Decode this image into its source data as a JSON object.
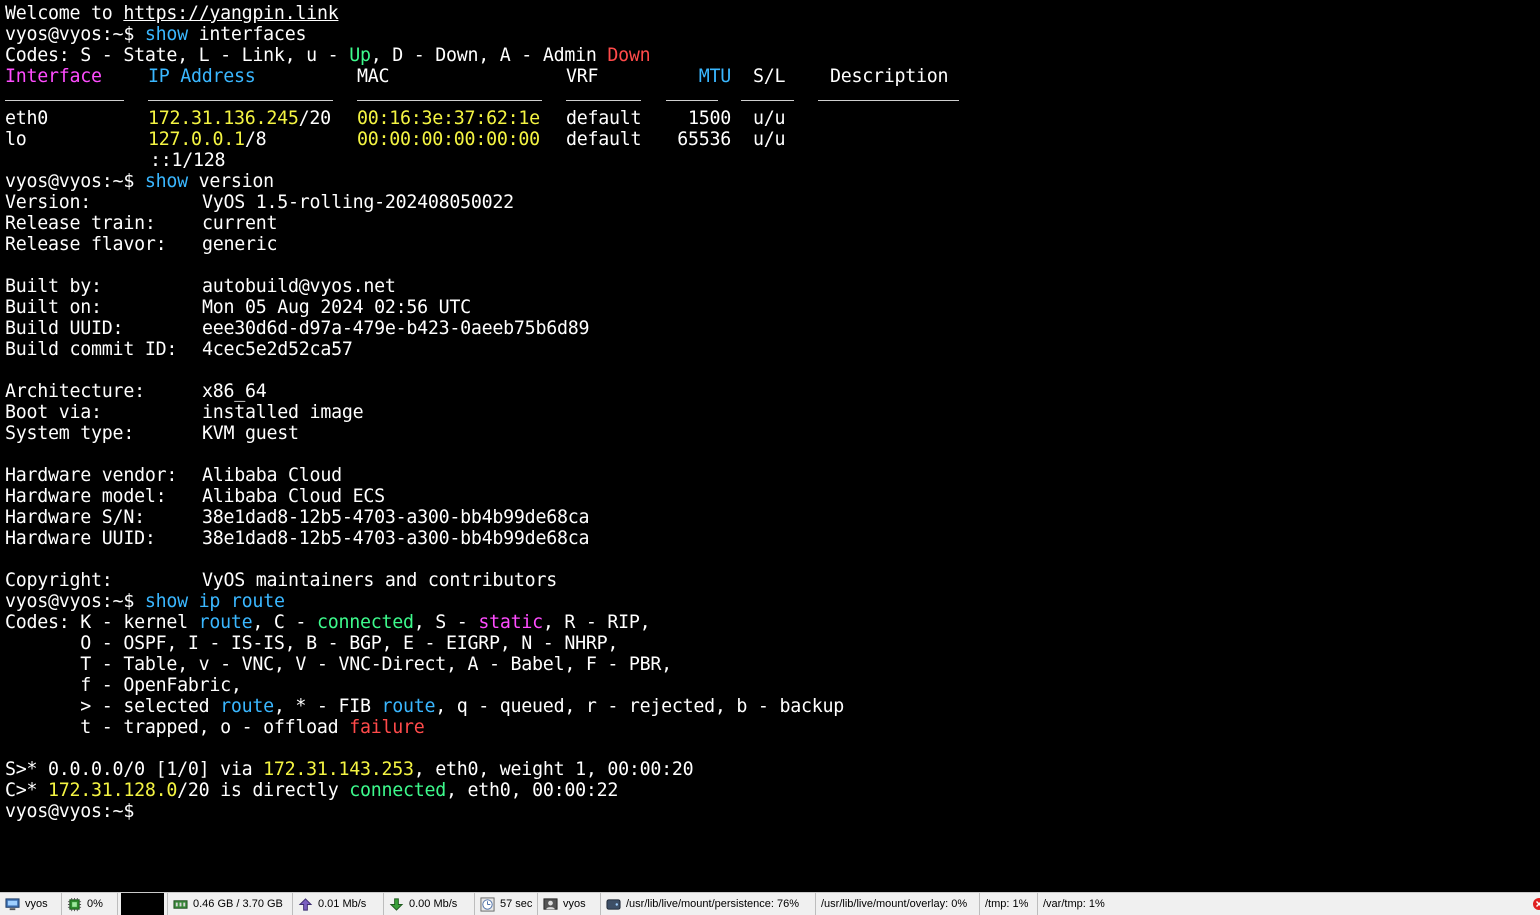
{
  "terminal": {
    "welcome": {
      "prefix": "Welcome to ",
      "link": "https://yangpin.link"
    },
    "prompt": "vyos@vyos:~$",
    "cmd_interfaces": {
      "keyword": "show",
      "rest": "interfaces"
    },
    "if_codes": {
      "a": "Codes: S - State, L - Link, u - ",
      "up": "Up",
      "b": ", D - Down, A - Admin ",
      "down": "Down"
    },
    "if_headers": {
      "interface": "Interface",
      "ip": "IP Address",
      "mac": "MAC",
      "vrf": "VRF",
      "mtu": "MTU",
      "sl": "S/L",
      "desc": "Description"
    },
    "if_rows": [
      {
        "iface": "eth0",
        "ip": "172.31.136.245",
        "mask": "/20",
        "mac": "00:16:3e:37:62:1e",
        "vrf": "default",
        "mtu": "1500",
        "sl": "u/u"
      },
      {
        "iface": "lo",
        "ip": "127.0.0.1",
        "mask": "/8",
        "mac": "00:00:00:00:00:00",
        "vrf": "default",
        "mtu": "65536",
        "sl": "u/u"
      }
    ],
    "if_extra_ip": "::1/128",
    "cmd_version": {
      "keyword": "show",
      "rest": "version"
    },
    "version_lines": [
      {
        "k": "Version:",
        "v": "VyOS 1.5-rolling-202408050022"
      },
      {
        "k": "Release train:",
        "v": "current"
      },
      {
        "k": "Release flavor:",
        "v": "generic"
      },
      {
        "k": "",
        "v": ""
      },
      {
        "k": "Built by:",
        "v": "autobuild@vyos.net"
      },
      {
        "k": "Built on:",
        "v": "Mon 05 Aug 2024 02:56 UTC"
      },
      {
        "k": "Build UUID:",
        "v": "eee30d6d-d97a-479e-b423-0aeeb75b6d89"
      },
      {
        "k": "Build commit ID:",
        "v": "4cec5e2d52ca57"
      },
      {
        "k": "",
        "v": ""
      },
      {
        "k": "Architecture:",
        "v": "x86_64"
      },
      {
        "k": "Boot via:",
        "v": "installed image"
      },
      {
        "k": "System type:",
        "v": "KVM guest"
      },
      {
        "k": "",
        "v": ""
      },
      {
        "k": "Hardware vendor:",
        "v": "Alibaba Cloud"
      },
      {
        "k": "Hardware model:",
        "v": "Alibaba Cloud ECS"
      },
      {
        "k": "Hardware S/N:",
        "v": "38e1dad8-12b5-4703-a300-bb4b99de68ca"
      },
      {
        "k": "Hardware UUID:",
        "v": "38e1dad8-12b5-4703-a300-bb4b99de68ca"
      },
      {
        "k": "",
        "v": ""
      },
      {
        "k": "Copyright:",
        "v": "VyOS maintainers and contributors"
      }
    ],
    "cmd_route": {
      "keyword": "show",
      "ip": "ip",
      "route": "route"
    },
    "route_codes": {
      "l1a": "Codes: K - kernel ",
      "l1route": "route",
      "l1b": ", C - ",
      "l1connected": "connected",
      "l1c": ", S - ",
      "l1static": "static",
      "l1d": ", R - RIP,",
      "l2": "       O - OSPF, I - IS-IS, B - BGP, E - EIGRP, N - NHRP,",
      "l3": "       T - Table, v - VNC, V - VNC-Direct, A - Babel, F - PBR,",
      "l4": "       f - OpenFabric,",
      "l5a": "       > - selected ",
      "l5route": "route",
      "l5b": ", * - FIB ",
      "l5route2": "route",
      "l5c": ", q - queued, r - rejected, b - backup",
      "l6a": "       t - trapped, o - offload ",
      "l6failure": "failure"
    },
    "routes": {
      "r1a": "S>* 0.0.0.0/0 [1/0] via ",
      "r1ip": "172.31.143.253",
      "r1b": ", eth0, weight 1, 00:00:20",
      "r2a": "C>* ",
      "r2ip": "172.31.128.0",
      "r2b": "/20 is directly ",
      "r2connected": "connected",
      "r2c": ", eth0, 00:00:22"
    }
  },
  "statusbar": {
    "host": "vyos",
    "cpu": "0%",
    "memory": "0.46 GB / 3.70 GB",
    "net_up": "0.01 Mb/s",
    "net_down": "0.00 Mb/s",
    "uptime": "57 sec",
    "user": "vyos",
    "disks": [
      "/usr/lib/live/mount/persistence: 76%",
      "/usr/lib/live/mount/overlay: 0%",
      "/tmp: 1%",
      "/var/tmp: 1%"
    ],
    "colors": {
      "cpu_graph_bg": "#000000",
      "close_icon": "#e02020"
    }
  }
}
